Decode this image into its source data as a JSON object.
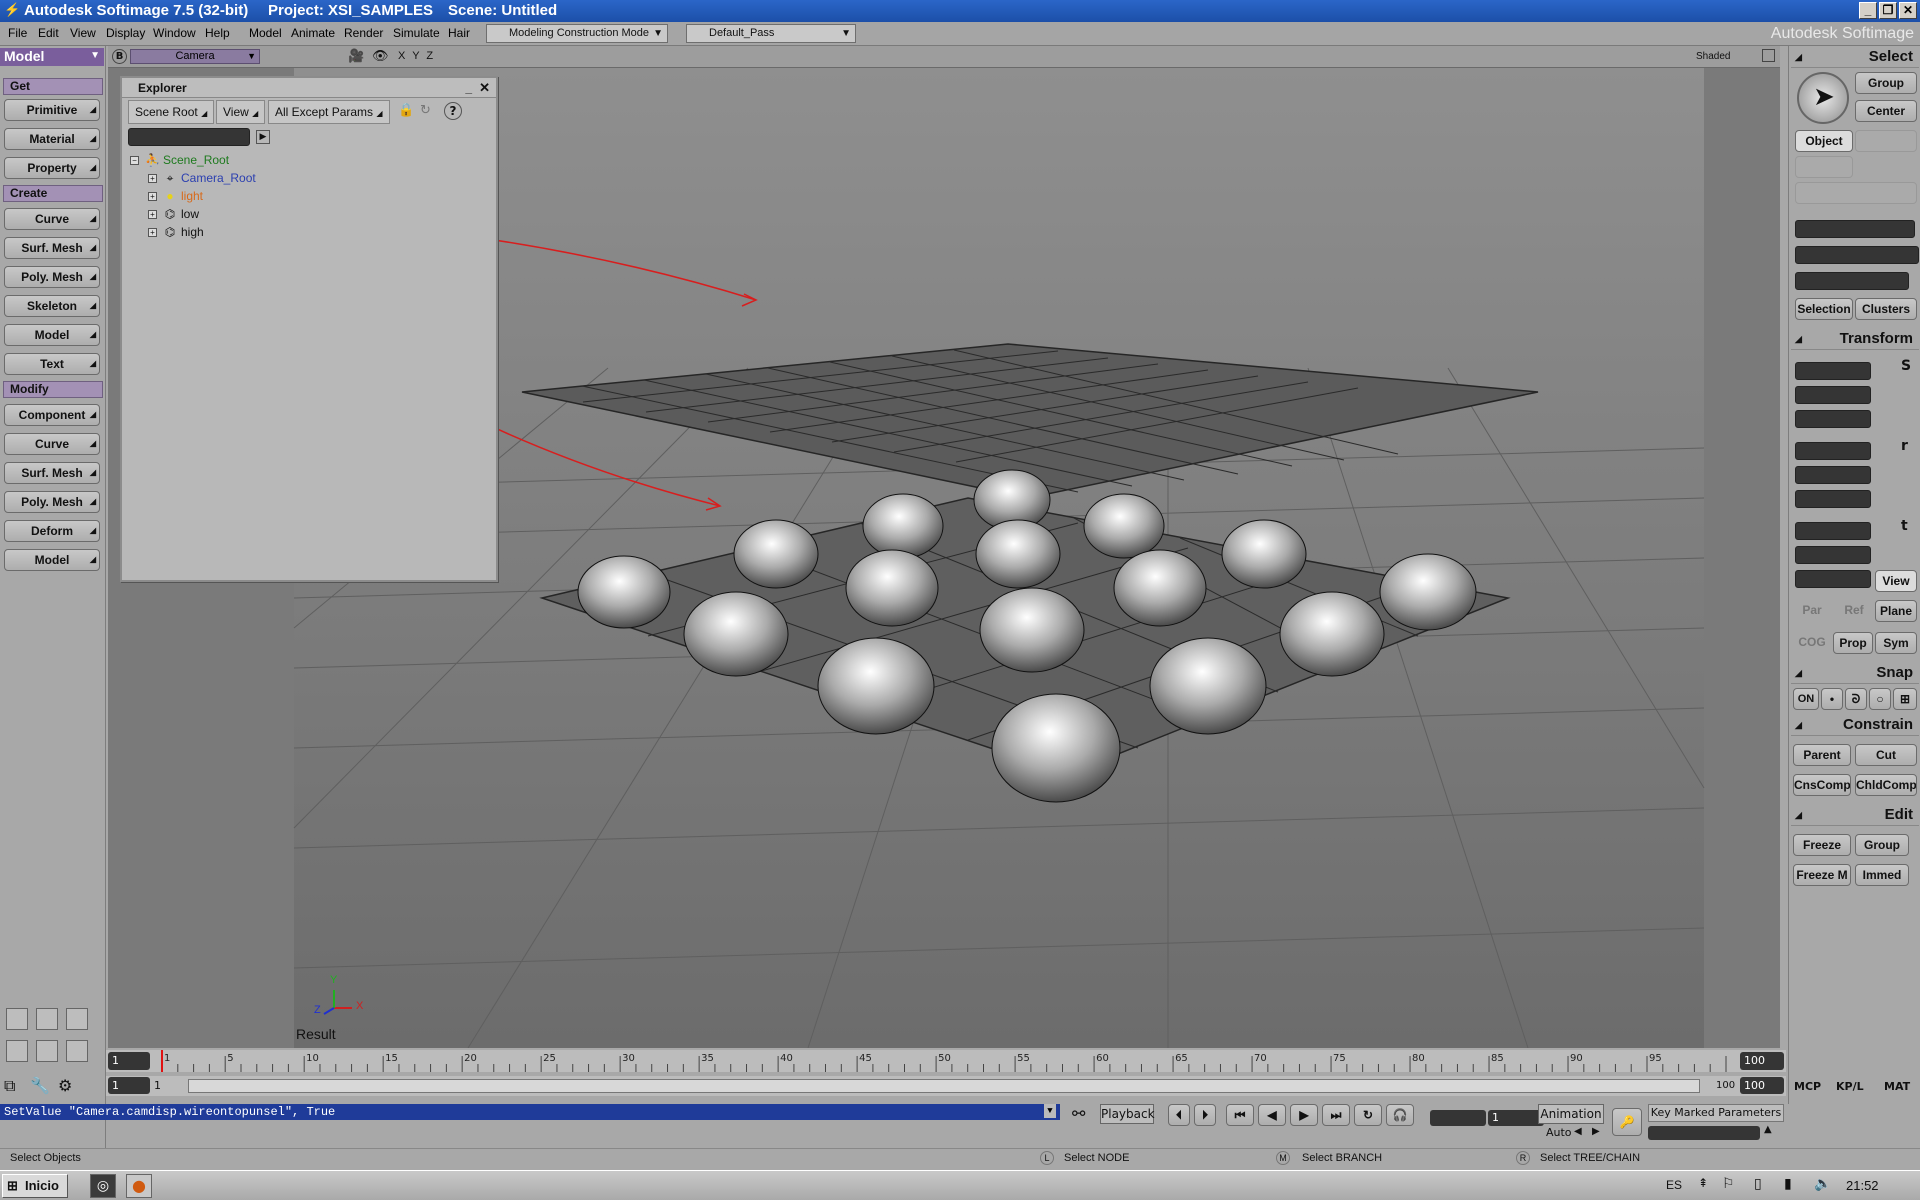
{
  "app": {
    "title": "Autodesk Softimage 7.5 (32-bit)",
    "project": "Project: XSI_SAMPLES",
    "scene": "Scene: Untitled",
    "brand": "Autodesk Softimage"
  },
  "menubar": {
    "items": [
      "File",
      "Edit",
      "View",
      "Display",
      "Window",
      "Help",
      "Model",
      "Animate",
      "Render",
      "Simulate",
      "Hair"
    ],
    "construction_mode": "Modeling Construction Mode",
    "pass": "Default_Pass"
  },
  "left_panel": {
    "module": "Model",
    "sections": [
      {
        "header": "Get",
        "buttons": [
          "Primitive",
          "Material",
          "Property"
        ]
      },
      {
        "header": "Create",
        "buttons": [
          "Curve",
          "Surf. Mesh",
          "Poly. Mesh",
          "Skeleton",
          "Model",
          "Text"
        ]
      },
      {
        "header": "Modify",
        "buttons": [
          "Component",
          "Curve",
          "Surf. Mesh",
          "Poly. Mesh",
          "Deform",
          "Model"
        ]
      }
    ]
  },
  "viewport": {
    "view_label": "B",
    "camera": "Camera",
    "axes_label": "X Y Z",
    "display_mode": "Shaded",
    "result_label": "Result",
    "axis_x": "X",
    "axis_y": "Y",
    "axis_z": "Z"
  },
  "explorer": {
    "title": "Explorer",
    "buttons": [
      "Scene Root",
      "View",
      "All Except Params"
    ],
    "tree": [
      {
        "label": "Scene_Root",
        "color": "#1e7a1e",
        "icon": "scene-root-icon"
      },
      {
        "label": "Camera_Root",
        "color": "#2b3fb0",
        "icon": "camera-icon"
      },
      {
        "label": "light",
        "color": "#d86a1a",
        "icon": "light-icon"
      },
      {
        "label": "low",
        "color": "#000000",
        "icon": "polymesh-icon"
      },
      {
        "label": "high",
        "color": "#000000",
        "icon": "polymesh-icon"
      }
    ]
  },
  "right_panel": {
    "select_header": "Select",
    "select_buttons": [
      "Group",
      "Center",
      "Object"
    ],
    "selection_buttons": [
      "Selection",
      "Clusters"
    ],
    "transform_header": "Transform",
    "transform_buttons": [
      "View",
      "Par",
      "Ref",
      "Plane",
      "COG",
      "Prop",
      "Sym"
    ],
    "snap_header": "Snap",
    "snap_on": "ON",
    "constrain_header": "Constrain",
    "constrain_buttons": [
      "Parent",
      "Cut",
      "CnsComp",
      "ChldComp"
    ],
    "edit_header": "Edit",
    "edit_buttons": [
      "Freeze",
      "Group",
      "Freeze M",
      "Immed"
    ]
  },
  "timeline": {
    "start": "1",
    "end": "100",
    "current": "1",
    "ticks": [
      "1",
      "5",
      "10",
      "15",
      "20",
      "25",
      "30",
      "35",
      "40",
      "45",
      "50",
      "55",
      "60",
      "65",
      "70",
      "75",
      "80",
      "85",
      "90",
      "95"
    ],
    "range_start": "1",
    "range_current": "1",
    "range_end_label": "100",
    "range_end": "100"
  },
  "tabs": [
    "MCP",
    "KP/L",
    "MAT"
  ],
  "command_line": "SetValue \"Camera.camdisp.wireontopunsel\", True",
  "playback": {
    "label": "Playback",
    "frame": "1",
    "animation": "Animation",
    "auto": "Auto",
    "key_marked": "Key Marked Parameters"
  },
  "status": {
    "left": "Select Objects",
    "l_key": "L",
    "l_text": "Select NODE",
    "m_key": "M",
    "m_text": "Select BRANCH",
    "r_key": "R",
    "r_text": "Select TREE/CHAIN"
  },
  "taskbar": {
    "start": "Inicio",
    "lang": "ES",
    "clock": "21:52"
  }
}
